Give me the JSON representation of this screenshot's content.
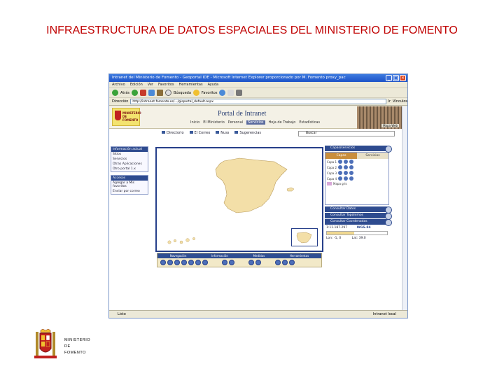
{
  "slide": {
    "title": "INFRAESTRUCTURA DE DATOS ESPACIALES DEL MINISTERIO DE FOMENTO",
    "footer_logo_lines": [
      "MINISTERIO",
      "DE",
      "FOMENTO"
    ]
  },
  "browser": {
    "window_title": "Intranet del Ministerio de Fomento - Geoportal IDE - Microsoft Internet Explorer proporcionado por M. Fomento proxy_pac",
    "menu": [
      "Archivo",
      "Edición",
      "Ver",
      "Favoritos",
      "Herramientas",
      "Ayuda"
    ],
    "toolbar": {
      "back": "Atrás",
      "search": "Búsqueda",
      "favorites": "Favoritos"
    },
    "address_label": "Dirección",
    "address_value": "http://intranet.fomento.es/.../gisportal_default.aspx",
    "go": "Ir",
    "links": "Vínculos",
    "status_left": "Listo",
    "status_right": "Intranet local"
  },
  "portal": {
    "title": "Portal de Intranet",
    "logo_text": "MINISTERIO DE FOMENTO",
    "nav": [
      "Inicio",
      "El Ministerio",
      "Personal",
      "Servicios",
      "Hoja de Trabajo",
      "Estadísticas"
    ],
    "nav_active": "Servicios",
    "building_caption": "Mapa Web",
    "subnav": [
      "Directorio",
      "El Correo",
      "Nuss",
      "Sugerencias"
    ],
    "search_placeholder": "Buscar"
  },
  "left_panel": {
    "box1_title": "Información actual",
    "box1_items": [
      "Sitios",
      "Servicios",
      "Otras Aplicaciones",
      "Otro portal 1.x"
    ],
    "box2_title": "Accesos",
    "box2_items": [
      "Agregar a Mis favoritos",
      "Enviar por correo"
    ]
  },
  "map_toolbar": {
    "sections": [
      "Navegación",
      "Información",
      "Medidas",
      "Herramientas"
    ]
  },
  "right_panel": {
    "header1": "Capas/servicios",
    "tab_on": "Capas",
    "tab_off": "Servicios",
    "layers": [
      "Capa 1",
      "Capa 2",
      "Capa 3",
      "Capa 4"
    ],
    "legend_label": "Mapa gris",
    "header2": "Consultar Datos",
    "header3": "Consultar Topónimos",
    "header4": "Consultar Coordenadas",
    "scale": "1:11.187.297",
    "crs": "WGS-84",
    "coord_x": "Lon: -1, 0",
    "coord_y": "Lat: 39.0",
    "scale_fraction": 0.45
  }
}
